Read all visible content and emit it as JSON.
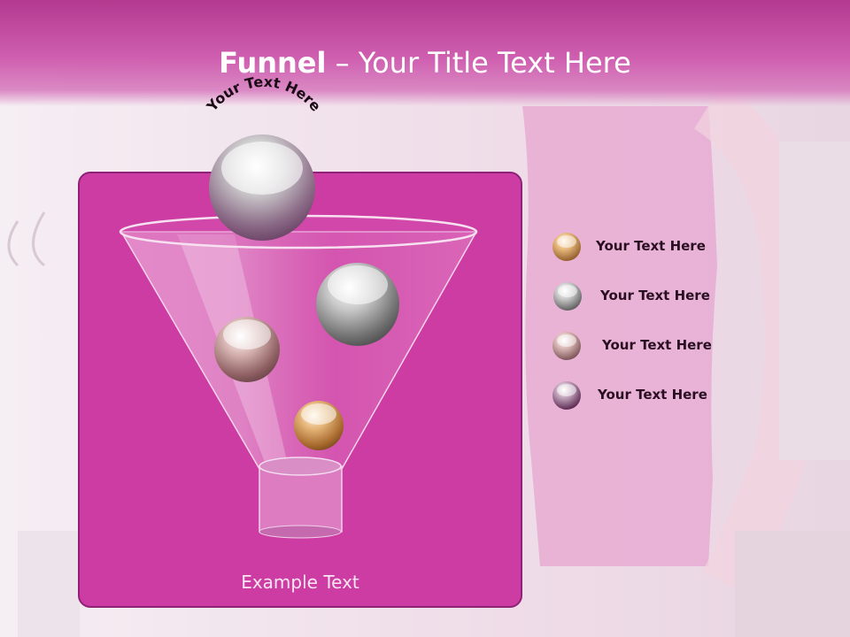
{
  "slide": {
    "title_bold": "Funnel",
    "title_rest": " – Your Title Text Here",
    "top_curved_text": "Your Text Here",
    "example_text": "Example Text"
  },
  "legend": [
    {
      "label": "Your  Text Here",
      "ball": "amber-ball"
    },
    {
      "label": "Your  Text Here",
      "ball": "gray-ball"
    },
    {
      "label": "Your  Text Here",
      "ball": "rose-ball"
    },
    {
      "label": "Your  Text Here",
      "ball": "plum-ball"
    }
  ],
  "colors": {
    "header": "#b3398f",
    "panel": "#cd3ca3",
    "panel_border": "#8e2277",
    "title_text": "#ffffff",
    "legend_text": "#2a0f22",
    "amber": "#c58a4a",
    "gray": "#8b8b8b",
    "rose": "#b08080",
    "plum": "#8a3a78"
  }
}
